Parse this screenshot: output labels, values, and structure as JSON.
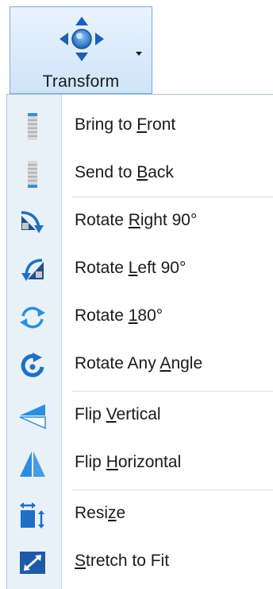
{
  "ribbon": {
    "button_label": "Transform",
    "icon": "transform-arrows-icon",
    "dropdown_icon": "dropdown-arrow-icon"
  },
  "menu": {
    "items": [
      {
        "pre": "Bring to ",
        "u": "F",
        "post": "ront",
        "icon": "bring-to-front-icon"
      },
      {
        "pre": "Send to ",
        "u": "B",
        "post": "ack",
        "icon": "send-to-back-icon"
      },
      {
        "pre": "Rotate ",
        "u": "R",
        "post": "ight 90°",
        "icon": "rotate-right-icon"
      },
      {
        "pre": "Rotate ",
        "u": "L",
        "post": "eft 90°",
        "icon": "rotate-left-icon"
      },
      {
        "pre": "Rotate ",
        "u": "1",
        "post": "80°",
        "icon": "rotate-180-icon"
      },
      {
        "pre": "Rotate Any ",
        "u": "A",
        "post": "ngle",
        "icon": "rotate-any-angle-icon"
      },
      {
        "pre": "Flip ",
        "u": "V",
        "post": "ertical",
        "icon": "flip-vertical-icon"
      },
      {
        "pre": "Flip ",
        "u": "H",
        "post": "orizontal",
        "icon": "flip-horizontal-icon"
      },
      {
        "pre": "Resi",
        "u": "z",
        "post": "e",
        "icon": "resize-icon"
      },
      {
        "pre": "",
        "u": "S",
        "post": "tretch to Fit",
        "icon": "stretch-to-fit-icon"
      }
    ]
  },
  "colors": {
    "accent_blue": "#1f6fc5",
    "icon_light_blue": "#4a9be0",
    "menu_gutter": "#e8f0f8",
    "ribbon_border": "#79a9dc"
  }
}
